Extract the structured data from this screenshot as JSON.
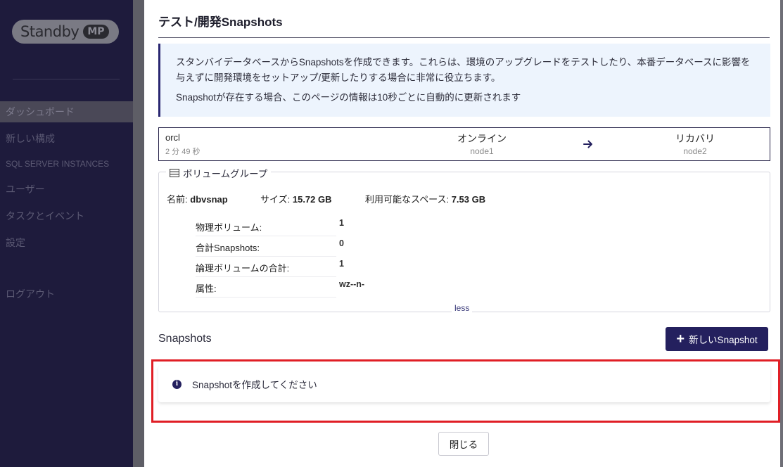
{
  "sidebar": {
    "logo_text": "Standby",
    "logo_badge": "MP",
    "items": [
      {
        "label": "ダッシュボード",
        "active": true
      },
      {
        "label": "新しい構成"
      },
      {
        "label": "SQL SERVER INSTANCES"
      },
      {
        "label": "ユーザー"
      },
      {
        "label": "タスクとイベント"
      },
      {
        "label": "設定"
      },
      {
        "label": "ログアウト"
      }
    ]
  },
  "modal": {
    "title": "テスト/開発Snapshots",
    "info_line1": "スタンバイデータベースからSnapshotsを作成できます。これらは、環境のアップグレードをテストしたり、本番データベースに影響を与えずに開発環境をセットアップ/更新したりする場合に非常に役立ちます。",
    "info_line2": "Snapshotが存在する場合、このページの情報は10秒ごとに自動的に更新されます",
    "database": {
      "name": "orcl",
      "age": "2 分 49 秒",
      "source_status": "オンライン",
      "source_node": "node1",
      "target_status": "リカバリ",
      "target_node": "node2"
    },
    "volume_group": {
      "legend": "ボリュームグループ",
      "name_label": "名前:",
      "name_value": "dbvsnap",
      "size_label": "サイズ:",
      "size_value": "15.72 GB",
      "free_label": "利用可能なスペース:",
      "free_value": "7.53 GB",
      "rows": [
        {
          "label": "物理ボリューム:",
          "value": "1"
        },
        {
          "label": "合計Snapshots:",
          "value": "0"
        },
        {
          "label": "論理ボリュームの合計:",
          "value": "1"
        },
        {
          "label": "属性:",
          "value": "wz--n-"
        }
      ],
      "toggle_label": "less"
    },
    "snapshots_heading": "Snapshots",
    "new_button_label": "新しいSnapshot",
    "empty_message": "Snapshotを作成してください",
    "close_button_label": "閉じる"
  },
  "colors": {
    "primary": "#24205e",
    "sidebar_bg": "#1e1b3c",
    "info_bg": "#edf4fd",
    "highlight": "#e01e25"
  }
}
